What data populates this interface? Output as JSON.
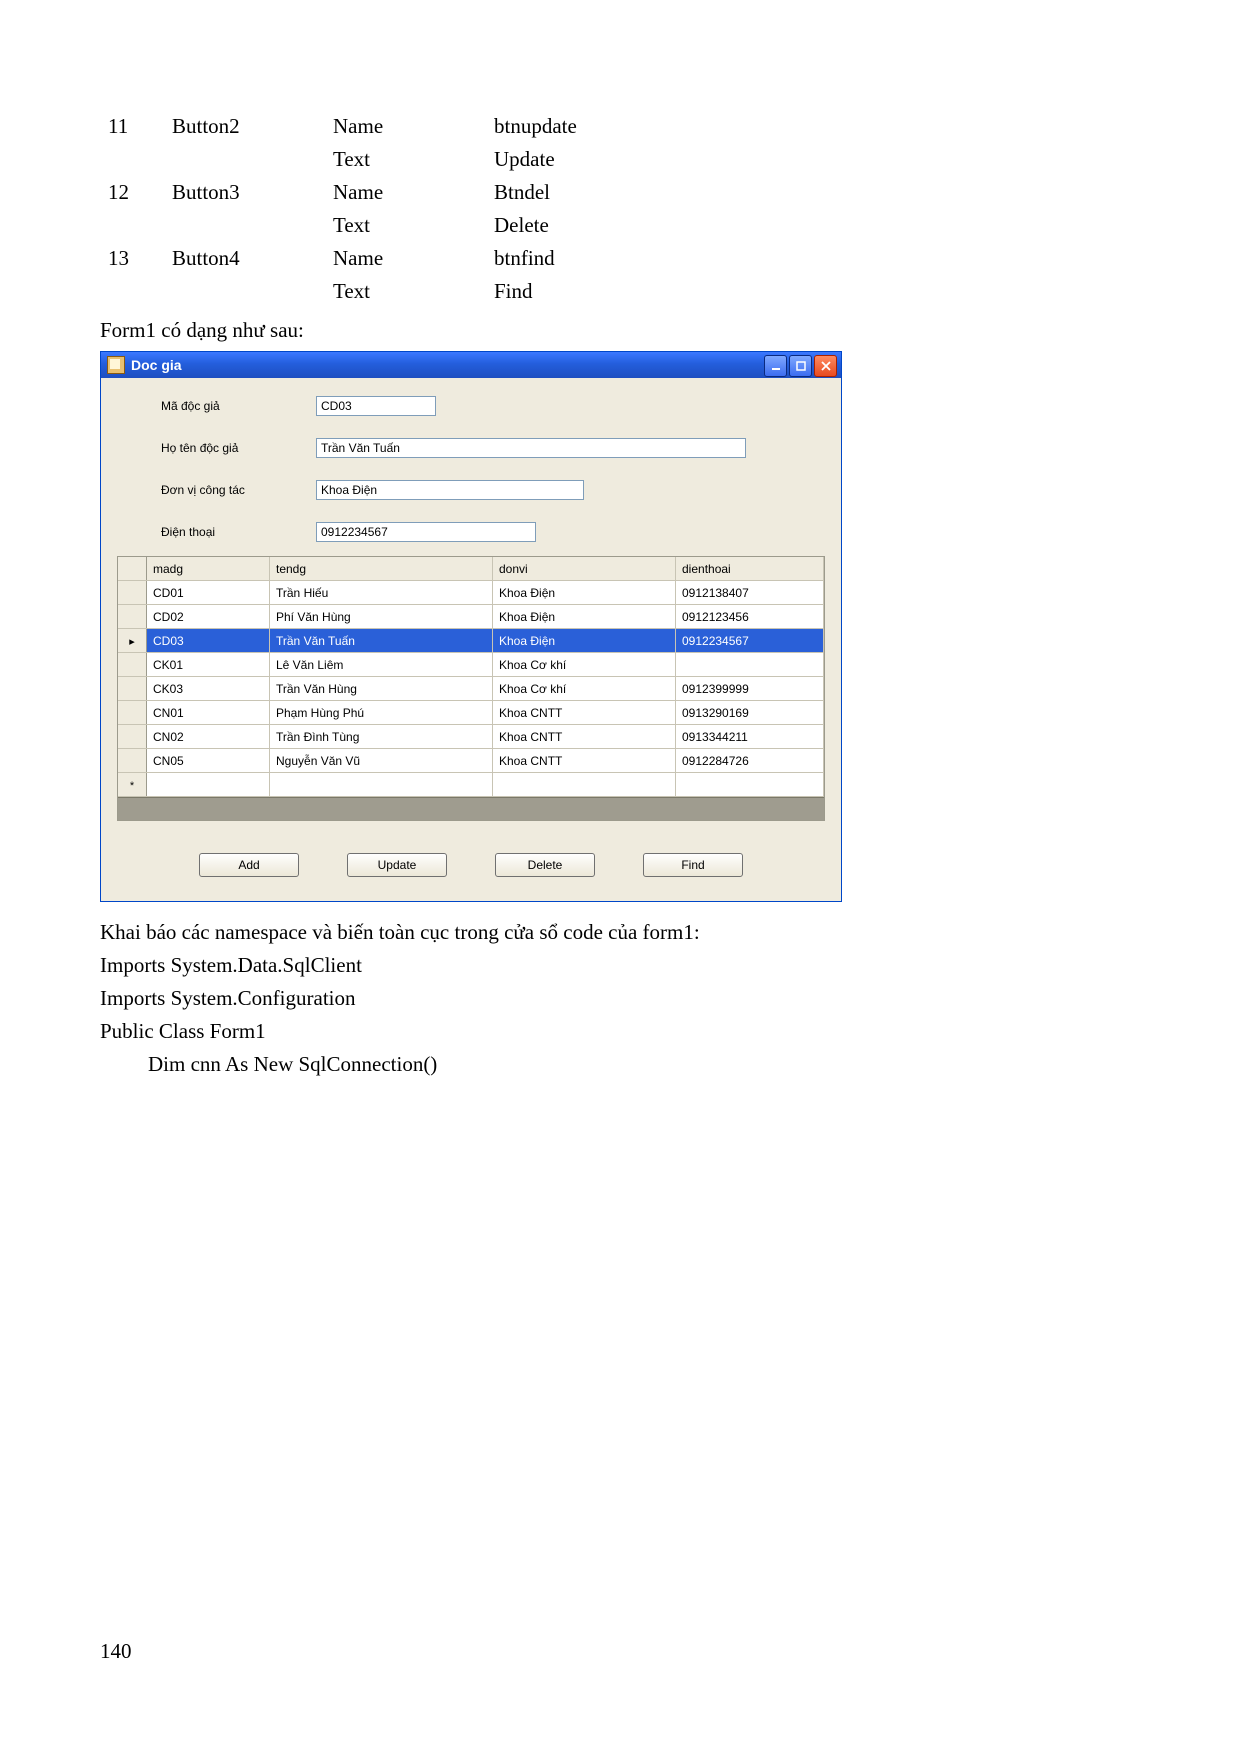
{
  "props_rows": [
    {
      "n": "11",
      "ctl": "Button2",
      "p1": "Name",
      "v1": "btnupdate",
      "p2": "Text",
      "v2": "Update"
    },
    {
      "n": "12",
      "ctl": "Button3",
      "p1": "Name",
      "v1": "Btndel",
      "p2": "Text",
      "v2": "Delete"
    },
    {
      "n": "13",
      "ctl": "Button4",
      "p1": "Name",
      "v1": "btnfind",
      "p2": "Text",
      "v2": "Find"
    }
  ],
  "caption": "Form1 có dạng như sau:",
  "window": {
    "title": "Doc gia",
    "fields": {
      "madg_label": "Mã độc giả",
      "madg_value": "CD03",
      "tendg_label": "Họ tên độc giả",
      "tendg_value": "Trần Văn Tuấn",
      "donvi_label": "Đơn vị công tác",
      "donvi_value": "Khoa Điện",
      "dt_label": "Điện thoại",
      "dt_value": "0912234567"
    },
    "grid": {
      "headers": [
        "madg",
        "tendg",
        "donvi",
        "dienthoai"
      ],
      "selected_index": 2,
      "rows": [
        {
          "madg": "CD01",
          "tendg": "Trần Hiếu",
          "donvi": "Khoa Điện",
          "dienthoai": "0912138407"
        },
        {
          "madg": "CD02",
          "tendg": "Phí Văn Hùng",
          "donvi": "Khoa Điện",
          "dienthoai": "0912123456"
        },
        {
          "madg": "CD03",
          "tendg": "Trần Văn Tuấn",
          "donvi": "Khoa Điện",
          "dienthoai": "0912234567"
        },
        {
          "madg": "CK01",
          "tendg": "Lê Văn Liêm",
          "donvi": "Khoa Cơ khí",
          "dienthoai": ""
        },
        {
          "madg": "CK03",
          "tendg": "Trần Văn Hùng",
          "donvi": "Khoa Cơ khí",
          "dienthoai": "0912399999"
        },
        {
          "madg": "CN01",
          "tendg": "Phạm Hùng Phú",
          "donvi": "Khoa CNTT",
          "dienthoai": "0913290169"
        },
        {
          "madg": "CN02",
          "tendg": "Trần Đình Tùng",
          "donvi": "Khoa CNTT",
          "dienthoai": "0913344211"
        },
        {
          "madg": "CN05",
          "tendg": "Nguyễn Văn Vũ",
          "donvi": "Khoa CNTT",
          "dienthoai": "0912284726"
        }
      ]
    },
    "buttons": {
      "add": "Add",
      "update": "Update",
      "delete": "Delete",
      "find": "Find"
    }
  },
  "after": {
    "l1": "Khai báo các namespace và biến toàn cục trong cửa sổ code của form1:",
    "l2": "Imports System.Data.SqlClient",
    "l3": "Imports System.Configuration",
    "l4": "Public Class Form1",
    "l5": "Dim cnn As New SqlConnection()"
  },
  "page_number": "140"
}
